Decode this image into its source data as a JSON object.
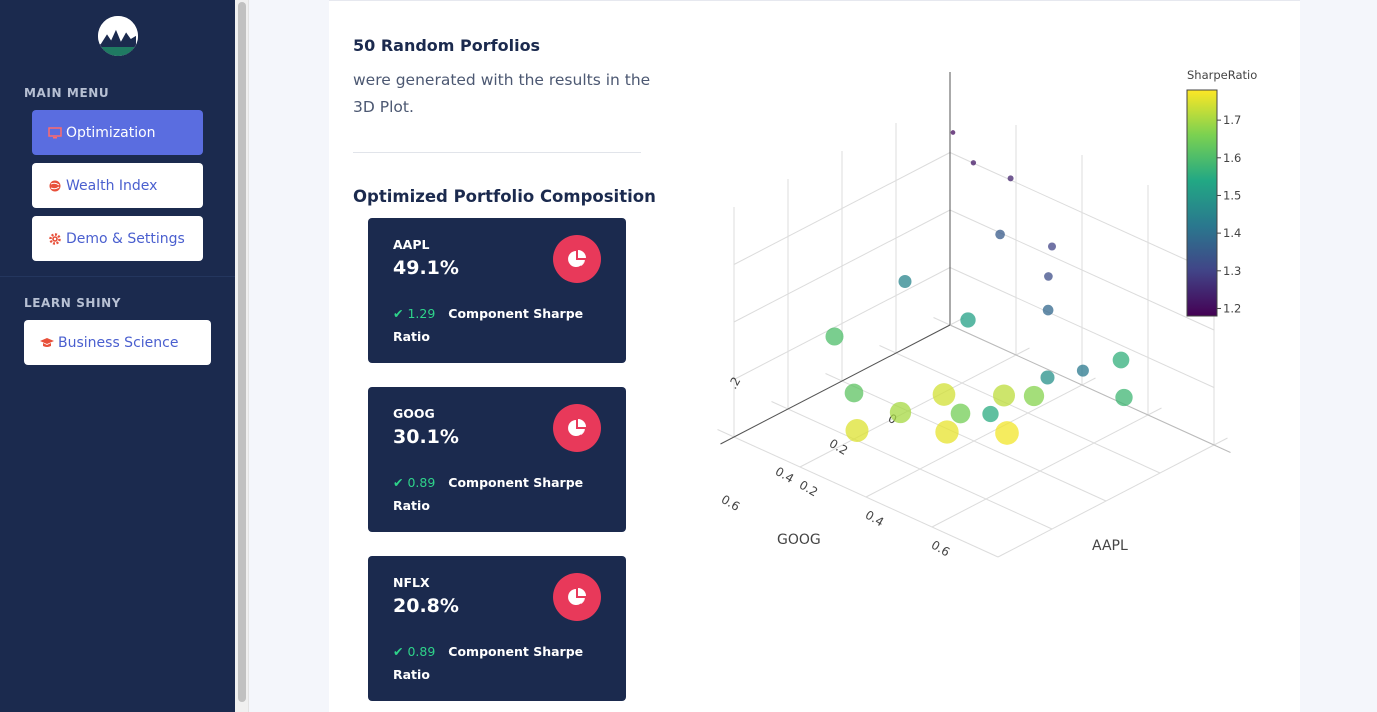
{
  "sidebar": {
    "logo_icon": "mountain-logo-icon",
    "main_menu_heading": "MAIN MENU",
    "items": [
      {
        "label": "Optimization",
        "icon": "monitor-icon",
        "active": true
      },
      {
        "label": "Wealth Index",
        "icon": "globe-icon",
        "active": false
      },
      {
        "label": "Demo & Settings",
        "icon": "gear-icon",
        "active": false
      }
    ],
    "learn_heading": "LEARN SHINY",
    "learn_item": {
      "label": "Business Science",
      "icon": "graduation-cap-icon"
    }
  },
  "main": {
    "title": "50 Random Porfolios",
    "lead": "were generated with the results in the 3D Plot.",
    "composition_title": "Optimized Portfolio Composition",
    "cards": [
      {
        "ticker": "AAPL",
        "weight": "49.1%",
        "sharpe": "1.29",
        "sharpe_label": "Component Sharpe Ratio",
        "icon": "pie-chart-icon"
      },
      {
        "ticker": "GOOG",
        "weight": "30.1%",
        "sharpe": "0.89",
        "sharpe_label": "Component Sharpe Ratio",
        "icon": "pie-chart-icon"
      },
      {
        "ticker": "NFLX",
        "weight": "20.8%",
        "sharpe": "0.89",
        "sharpe_label": "Component Sharpe Ratio",
        "icon": "pie-chart-icon"
      }
    ]
  },
  "colors": {
    "sidebar_bg": "#1b2a4e",
    "active_button": "#5a6de0",
    "card_bg": "#1b2a4e",
    "badge": "#e8395a",
    "check": "#2ed38a"
  },
  "chart_data": {
    "type": "scatter",
    "subtype": "3d-scatter",
    "x_axis_label": "AAPL",
    "y_axis_label": "GOOG",
    "x_ticks": [
      "0.2",
      "0.4",
      "0.6"
    ],
    "y_ticks": [
      "0",
      "0.2",
      "0.4",
      "0.6"
    ],
    "z_ticks": [
      ".2"
    ],
    "colorbar": {
      "title": "SharpeRatio",
      "ticks": [
        "1.7",
        "1.6",
        "1.5",
        "1.4",
        "1.3",
        "1.2"
      ],
      "range": [
        1.18,
        1.78
      ],
      "colorscale": "viridis"
    },
    "points_count": 50,
    "points": [
      {
        "aapl": 0.05,
        "goog": 0.05,
        "nflx": 0.9,
        "sharpe": 1.2
      },
      {
        "aapl": 0.12,
        "goog": 0.06,
        "nflx": 0.82,
        "sharpe": 1.22
      },
      {
        "aapl": 0.2,
        "goog": 0.02,
        "nflx": 0.78,
        "sharpe": 1.24
      },
      {
        "aapl": 0.35,
        "goog": 0.05,
        "nflx": 0.6,
        "sharpe": 1.3
      },
      {
        "aapl": 0.38,
        "goog": 0.1,
        "nflx": 0.52,
        "sharpe": 1.32
      },
      {
        "aapl": 0.25,
        "goog": 0.12,
        "nflx": 0.63,
        "sharpe": 1.35
      },
      {
        "aapl": 0.42,
        "goog": 0.15,
        "nflx": 0.43,
        "sharpe": 1.38
      },
      {
        "aapl": 0.15,
        "goog": 0.35,
        "nflx": 0.5,
        "sharpe": 1.45
      },
      {
        "aapl": 0.55,
        "goog": 0.18,
        "nflx": 0.27,
        "sharpe": 1.42
      },
      {
        "aapl": 0.5,
        "goog": 0.25,
        "nflx": 0.25,
        "sharpe": 1.48
      },
      {
        "aapl": 0.3,
        "goog": 0.3,
        "nflx": 0.4,
        "sharpe": 1.52
      },
      {
        "aapl": 0.45,
        "goog": 0.4,
        "nflx": 0.15,
        "sharpe": 1.55
      },
      {
        "aapl": 0.6,
        "goog": 0.1,
        "nflx": 0.3,
        "sharpe": 1.56
      },
      {
        "aapl": 0.65,
        "goog": 0.15,
        "nflx": 0.2,
        "sharpe": 1.58
      },
      {
        "aapl": 0.1,
        "goog": 0.55,
        "nflx": 0.35,
        "sharpe": 1.6
      },
      {
        "aapl": 0.2,
        "goog": 0.6,
        "nflx": 0.2,
        "sharpe": 1.62
      },
      {
        "aapl": 0.4,
        "goog": 0.45,
        "nflx": 0.15,
        "sharpe": 1.65
      },
      {
        "aapl": 0.5,
        "goog": 0.3,
        "nflx": 0.2,
        "sharpe": 1.67
      },
      {
        "aapl": 0.3,
        "goog": 0.55,
        "nflx": 0.15,
        "sharpe": 1.7
      },
      {
        "aapl": 0.45,
        "goog": 0.35,
        "nflx": 0.2,
        "sharpe": 1.72
      },
      {
        "aapl": 0.35,
        "goog": 0.45,
        "nflx": 0.2,
        "sharpe": 1.74
      },
      {
        "aapl": 0.25,
        "goog": 0.65,
        "nflx": 0.1,
        "sharpe": 1.75
      },
      {
        "aapl": 0.4,
        "goog": 0.5,
        "nflx": 0.1,
        "sharpe": 1.76
      },
      {
        "aapl": 0.5,
        "goog": 0.4,
        "nflx": 0.1,
        "sharpe": 1.77
      }
    ]
  }
}
